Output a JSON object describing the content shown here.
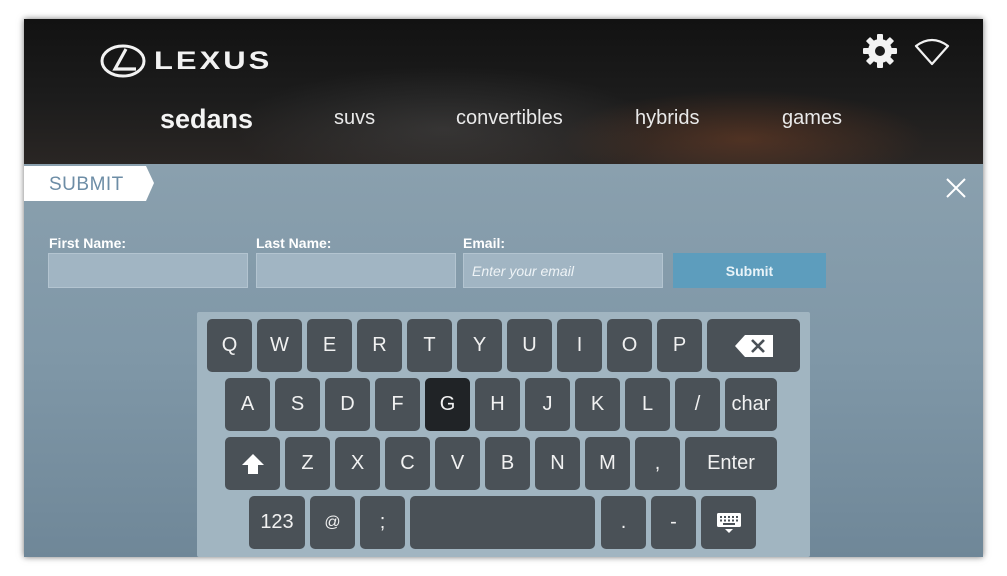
{
  "brand": {
    "name": "LEXUS"
  },
  "header": {
    "settings_icon": "gear-icon",
    "wifi_icon": "wifi-icon"
  },
  "nav": {
    "items": [
      {
        "label": "sedans",
        "active": true
      },
      {
        "label": "suvs",
        "active": false
      },
      {
        "label": "convertibles",
        "active": false
      },
      {
        "label": "hybrids",
        "active": false
      },
      {
        "label": "games",
        "active": false
      }
    ]
  },
  "form": {
    "tab_label": "SUBMIT",
    "first_name_label": "First Name:",
    "first_name_value": "",
    "last_name_label": "Last Name:",
    "last_name_value": "",
    "email_label": "Email:",
    "email_placeholder": "Enter your email",
    "email_value": "",
    "submit_label": "Submit",
    "close_icon": "close-icon"
  },
  "keyboard": {
    "row1": [
      "Q",
      "W",
      "E",
      "R",
      "T",
      "Y",
      "U",
      "I",
      "O",
      "P"
    ],
    "backspace_icon": "backspace-icon",
    "row2": [
      "A",
      "S",
      "D",
      "F",
      "G",
      "H",
      "J",
      "K",
      "L",
      "/"
    ],
    "char_label": "char",
    "active_key": "G",
    "shift_icon": "shift-icon",
    "row3": [
      "Z",
      "X",
      "C",
      "V",
      "B",
      "N",
      "M",
      ","
    ],
    "enter_label": "Enter",
    "row4": {
      "numbers_label": "123",
      "at": "@",
      "semicolon": ";",
      "period": ".",
      "dash": "-"
    },
    "hide_icon": "keyboard-hide-icon"
  }
}
